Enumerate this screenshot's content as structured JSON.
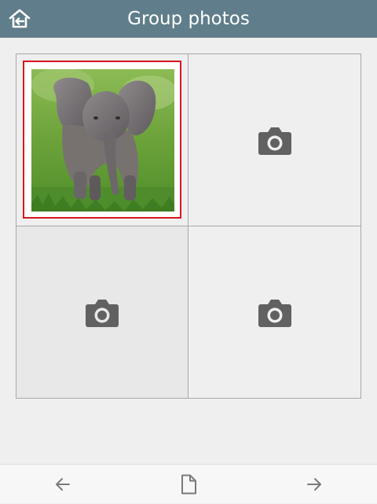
{
  "header": {
    "title": "Group photos",
    "home_icon": "home-back-icon",
    "background_color": "#5f7d8a"
  },
  "grid": {
    "cells": [
      {
        "content": "photo",
        "subject": "elephant-photo",
        "selected": true
      },
      {
        "content": "placeholder",
        "icon": "camera-icon",
        "selected": false
      },
      {
        "content": "placeholder",
        "icon": "camera-icon",
        "selected": false
      },
      {
        "content": "placeholder",
        "icon": "camera-icon",
        "selected": false
      }
    ],
    "selection_color": "#d9141e"
  },
  "bottom_bar": {
    "back_icon": "arrow-left-icon",
    "document_icon": "document-icon",
    "forward_icon": "arrow-right-icon"
  }
}
